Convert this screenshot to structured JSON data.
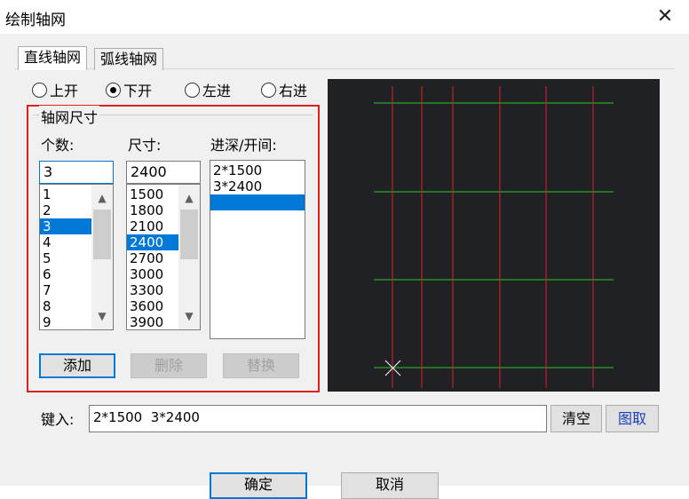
{
  "window": {
    "title": "绘制轴网",
    "close_glyph": "✕"
  },
  "tabs": [
    {
      "label": "直线轴网",
      "active": true
    },
    {
      "label": "弧线轴网",
      "active": false
    }
  ],
  "radios": [
    {
      "label": "上开",
      "checked": false
    },
    {
      "label": "下开",
      "checked": true
    },
    {
      "label": "左进",
      "checked": false
    },
    {
      "label": "右进",
      "checked": false
    }
  ],
  "group": {
    "label": "轴网尺寸",
    "count_label": "个数:",
    "size_label": "尺寸:",
    "depth_label": "进深/开间:",
    "count_value": "3",
    "size_value": "2400",
    "count_items": [
      "1",
      "2",
      "3",
      "4",
      "5",
      "6",
      "7",
      "8",
      "9"
    ],
    "count_selected": 2,
    "size_items": [
      "1500",
      "1800",
      "2100",
      "2400",
      "2700",
      "3000",
      "3300",
      "3600",
      "3900"
    ],
    "size_selected": 3,
    "depth_items": [
      "2*1500",
      "3*2400",
      ""
    ],
    "depth_selected": 2,
    "add_label": "添加",
    "delete_label": "删除",
    "replace_label": "替换"
  },
  "input": {
    "label": "键入:",
    "value": "2*1500  3*2400"
  },
  "buttons": {
    "clear": "清空",
    "pick": "图取",
    "ok": "确定",
    "cancel": "取消"
  },
  "icons": {
    "scroll_up": "chevron-up-icon",
    "scroll_down": "chevron-down-icon",
    "close": "close-icon"
  },
  "colors": {
    "accent": "#0078d7",
    "highlight_box": "#e02020",
    "preview_bg": "#202124",
    "axis_vertical": "#e02020",
    "axis_horizontal": "#22cc22"
  }
}
